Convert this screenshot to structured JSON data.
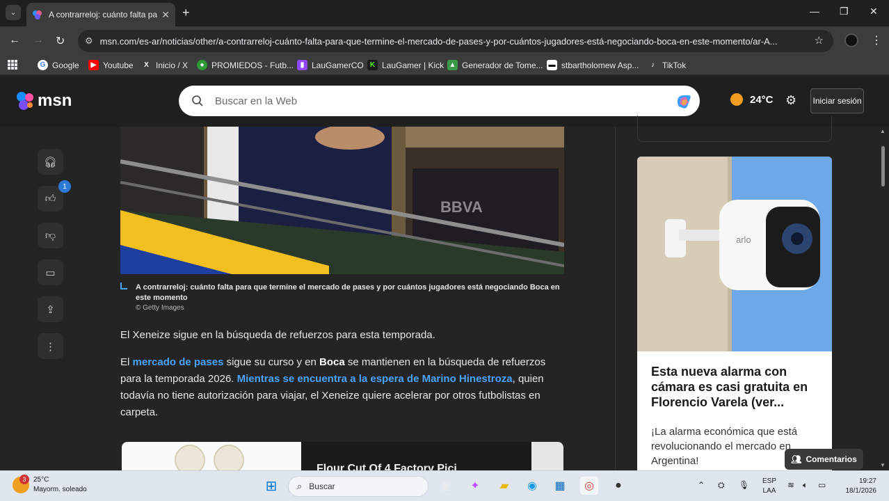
{
  "browser": {
    "tab_title": "A contrarreloj: cuánto falta para",
    "new_tab": "+",
    "url": "msn.com/es-ar/noticias/other/a-contrarreloj-cuánto-falta-para-que-termine-el-mercado-de-pases-y-por-cuántos-jugadores-está-negociando-boca-en-este-momento/ar-A...",
    "bookmarks": [
      {
        "label": "Google"
      },
      {
        "label": "Youtube"
      },
      {
        "label": "Inicio / X"
      },
      {
        "label": "PROMIEDOS - Futb..."
      },
      {
        "label": "LauGamerCO"
      },
      {
        "label": "LauGamer | Kick"
      },
      {
        "label": "Generador de Tome..."
      },
      {
        "label": "stbartholomew Asp..."
      },
      {
        "label": "TikTok"
      }
    ]
  },
  "msn": {
    "logo": "msn",
    "search_placeholder": "Buscar en la Web",
    "temperature": "24°C",
    "signin": "Iniciar sesión",
    "like_count": "1"
  },
  "article": {
    "caption": "A contrarreloj: cuánto falta para que termine el mercado de pases y por cuántos jugadores está negociando Boca en este momento",
    "credit": "© Getty Images",
    "p1": "El Xeneize sigue en la búsqueda de refuerzos para esta temporada.",
    "p2_a": "El ",
    "p2_link1": "mercado de pases",
    "p2_b": " sigue su curso y en ",
    "p2_bold": "Boca",
    "p2_c": " se mantienen en la búsqueda de refuerzos para la temporada 2026. ",
    "p2_link2": "Mientras se encuentra a la espera de Marino Hinestroza",
    "p2_d": ", quien todavía no tiene autorización para viajar, el Xeneize quiere acelerar por otros futbolistas en carpeta.",
    "bottom_ad_text": "Flour Cut Of 4 Factory Pici"
  },
  "rail_ad": {
    "headline": "Esta nueva alarma con cámara es casi gratuita en Florencio Varela (ver...",
    "description": "¡La alarma económica que está revolucionando el mercado en Argentina!",
    "camera_brand": "arlo"
  },
  "comments_label": "Comentarios",
  "taskbar": {
    "weather_temp": "25°C",
    "weather_desc": "Mayorm. soleado",
    "weather_badge": "3",
    "search_label": "Buscar",
    "lang_1": "ESP",
    "lang_2": "LAA",
    "time": "19:27",
    "date": "18/1/2026"
  },
  "colors": {
    "link": "#4aa3ff",
    "page_bg": "#242424",
    "header_bg": "#1f1f1f"
  }
}
